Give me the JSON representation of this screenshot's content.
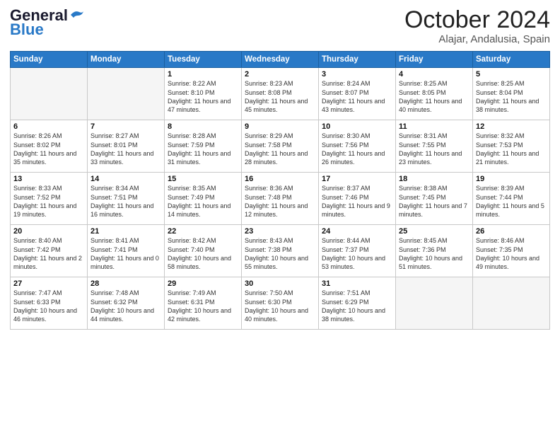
{
  "logo": {
    "line1": "General",
    "line2": "Blue"
  },
  "header": {
    "month": "October 2024",
    "location": "Alajar, Andalusia, Spain"
  },
  "weekdays": [
    "Sunday",
    "Monday",
    "Tuesday",
    "Wednesday",
    "Thursday",
    "Friday",
    "Saturday"
  ],
  "weeks": [
    [
      {
        "day": "",
        "info": ""
      },
      {
        "day": "",
        "info": ""
      },
      {
        "day": "1",
        "info": "Sunrise: 8:22 AM\nSunset: 8:10 PM\nDaylight: 11 hours and 47 minutes."
      },
      {
        "day": "2",
        "info": "Sunrise: 8:23 AM\nSunset: 8:08 PM\nDaylight: 11 hours and 45 minutes."
      },
      {
        "day": "3",
        "info": "Sunrise: 8:24 AM\nSunset: 8:07 PM\nDaylight: 11 hours and 43 minutes."
      },
      {
        "day": "4",
        "info": "Sunrise: 8:25 AM\nSunset: 8:05 PM\nDaylight: 11 hours and 40 minutes."
      },
      {
        "day": "5",
        "info": "Sunrise: 8:25 AM\nSunset: 8:04 PM\nDaylight: 11 hours and 38 minutes."
      }
    ],
    [
      {
        "day": "6",
        "info": "Sunrise: 8:26 AM\nSunset: 8:02 PM\nDaylight: 11 hours and 35 minutes."
      },
      {
        "day": "7",
        "info": "Sunrise: 8:27 AM\nSunset: 8:01 PM\nDaylight: 11 hours and 33 minutes."
      },
      {
        "day": "8",
        "info": "Sunrise: 8:28 AM\nSunset: 7:59 PM\nDaylight: 11 hours and 31 minutes."
      },
      {
        "day": "9",
        "info": "Sunrise: 8:29 AM\nSunset: 7:58 PM\nDaylight: 11 hours and 28 minutes."
      },
      {
        "day": "10",
        "info": "Sunrise: 8:30 AM\nSunset: 7:56 PM\nDaylight: 11 hours and 26 minutes."
      },
      {
        "day": "11",
        "info": "Sunrise: 8:31 AM\nSunset: 7:55 PM\nDaylight: 11 hours and 23 minutes."
      },
      {
        "day": "12",
        "info": "Sunrise: 8:32 AM\nSunset: 7:53 PM\nDaylight: 11 hours and 21 minutes."
      }
    ],
    [
      {
        "day": "13",
        "info": "Sunrise: 8:33 AM\nSunset: 7:52 PM\nDaylight: 11 hours and 19 minutes."
      },
      {
        "day": "14",
        "info": "Sunrise: 8:34 AM\nSunset: 7:51 PM\nDaylight: 11 hours and 16 minutes."
      },
      {
        "day": "15",
        "info": "Sunrise: 8:35 AM\nSunset: 7:49 PM\nDaylight: 11 hours and 14 minutes."
      },
      {
        "day": "16",
        "info": "Sunrise: 8:36 AM\nSunset: 7:48 PM\nDaylight: 11 hours and 12 minutes."
      },
      {
        "day": "17",
        "info": "Sunrise: 8:37 AM\nSunset: 7:46 PM\nDaylight: 11 hours and 9 minutes."
      },
      {
        "day": "18",
        "info": "Sunrise: 8:38 AM\nSunset: 7:45 PM\nDaylight: 11 hours and 7 minutes."
      },
      {
        "day": "19",
        "info": "Sunrise: 8:39 AM\nSunset: 7:44 PM\nDaylight: 11 hours and 5 minutes."
      }
    ],
    [
      {
        "day": "20",
        "info": "Sunrise: 8:40 AM\nSunset: 7:42 PM\nDaylight: 11 hours and 2 minutes."
      },
      {
        "day": "21",
        "info": "Sunrise: 8:41 AM\nSunset: 7:41 PM\nDaylight: 11 hours and 0 minutes."
      },
      {
        "day": "22",
        "info": "Sunrise: 8:42 AM\nSunset: 7:40 PM\nDaylight: 10 hours and 58 minutes."
      },
      {
        "day": "23",
        "info": "Sunrise: 8:43 AM\nSunset: 7:38 PM\nDaylight: 10 hours and 55 minutes."
      },
      {
        "day": "24",
        "info": "Sunrise: 8:44 AM\nSunset: 7:37 PM\nDaylight: 10 hours and 53 minutes."
      },
      {
        "day": "25",
        "info": "Sunrise: 8:45 AM\nSunset: 7:36 PM\nDaylight: 10 hours and 51 minutes."
      },
      {
        "day": "26",
        "info": "Sunrise: 8:46 AM\nSunset: 7:35 PM\nDaylight: 10 hours and 49 minutes."
      }
    ],
    [
      {
        "day": "27",
        "info": "Sunrise: 7:47 AM\nSunset: 6:33 PM\nDaylight: 10 hours and 46 minutes."
      },
      {
        "day": "28",
        "info": "Sunrise: 7:48 AM\nSunset: 6:32 PM\nDaylight: 10 hours and 44 minutes."
      },
      {
        "day": "29",
        "info": "Sunrise: 7:49 AM\nSunset: 6:31 PM\nDaylight: 10 hours and 42 minutes."
      },
      {
        "day": "30",
        "info": "Sunrise: 7:50 AM\nSunset: 6:30 PM\nDaylight: 10 hours and 40 minutes."
      },
      {
        "day": "31",
        "info": "Sunrise: 7:51 AM\nSunset: 6:29 PM\nDaylight: 10 hours and 38 minutes."
      },
      {
        "day": "",
        "info": ""
      },
      {
        "day": "",
        "info": ""
      }
    ]
  ]
}
